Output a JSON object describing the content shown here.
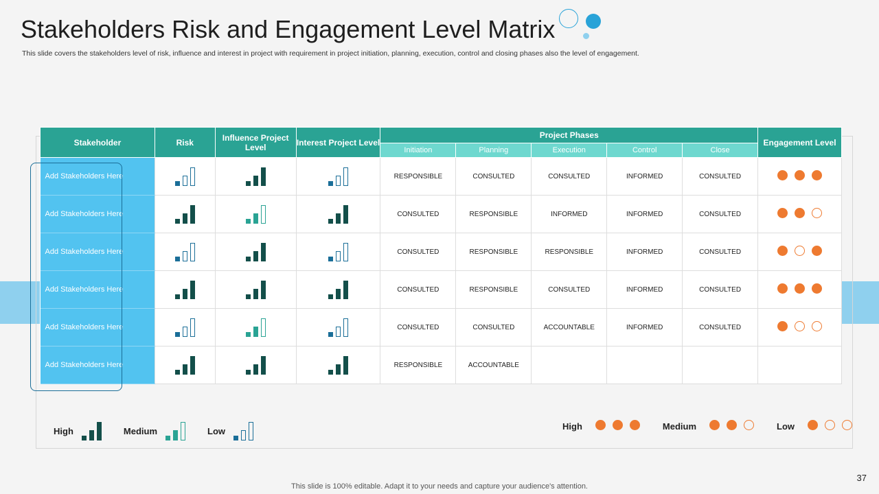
{
  "title": "Stakeholders Risk and Engagement Level Matrix",
  "subtitle": "This slide covers the stakeholders level of risk, influence and interest in project with requirement in project initiation, planning, execution, control and closing phases also the level of engagement.",
  "headers": {
    "stakeholder": "Stakeholder",
    "risk": "Risk",
    "influence": "Influence Project Level",
    "interest": "Interest Project Level",
    "phases": "Project Phases",
    "engagement": "Engagement Level",
    "phase_names": [
      "Initiation",
      "Planning",
      "Execution",
      "Control",
      "Close"
    ]
  },
  "rows": [
    {
      "name": "Add Stakeholders Here",
      "risk": "low",
      "influence": "high",
      "interest": "low",
      "phases": [
        "RESPONSIBLE",
        "CONSULTED",
        "CONSULTED",
        "INFORMED",
        "CONSULTED"
      ],
      "engagement": [
        1,
        1,
        1
      ]
    },
    {
      "name": "Add Stakeholders Here",
      "risk": "high",
      "influence": "medium",
      "interest": "high",
      "phases": [
        "CONSULTED",
        "RESPONSIBLE",
        "INFORMED",
        "INFORMED",
        "CONSULTED"
      ],
      "engagement": [
        1,
        1,
        0
      ]
    },
    {
      "name": "Add Stakeholders Here",
      "risk": "low",
      "influence": "high",
      "interest": "low",
      "phases": [
        "CONSULTED",
        "RESPONSIBLE",
        "RESPONSIBLE",
        "INFORMED",
        "CONSULTED"
      ],
      "engagement": [
        1,
        0,
        1
      ]
    },
    {
      "name": "Add Stakeholders Here",
      "risk": "high",
      "influence": "high",
      "interest": "high",
      "phases": [
        "CONSULTED",
        "RESPONSIBLE",
        "CONSULTED",
        "INFORMED",
        "CONSULTED"
      ],
      "engagement": [
        1,
        1,
        1
      ]
    },
    {
      "name": "Add Stakeholders Here",
      "risk": "low",
      "influence": "medium",
      "interest": "low",
      "phases": [
        "CONSULTED",
        "CONSULTED",
        "ACCOUNTABLE",
        "INFORMED",
        "CONSULTED"
      ],
      "engagement": [
        1,
        0,
        0
      ]
    },
    {
      "name": "Add Stakeholders Here",
      "risk": "high",
      "influence": "high",
      "interest": "high",
      "phases": [
        "RESPONSIBLE",
        "ACCOUNTABLE",
        "",
        "",
        ""
      ],
      "engagement": []
    }
  ],
  "legend_bars": [
    {
      "label": "High",
      "level": "high"
    },
    {
      "label": "Medium",
      "level": "medium"
    },
    {
      "label": "Low",
      "level": "low"
    }
  ],
  "legend_engagement": [
    {
      "label": "High",
      "dots": [
        1,
        1,
        1
      ]
    },
    {
      "label": "Medium",
      "dots": [
        1,
        1,
        0
      ]
    },
    {
      "label": "Low",
      "dots": [
        1,
        0,
        0
      ]
    }
  ],
  "colors": {
    "header": "#2aa394",
    "subheader": "#6ed8cf",
    "stakeholder": "#52c3f0",
    "orange": "#ee7a30"
  },
  "footer": "This slide is 100% editable. Adapt it to your needs and capture your audience's attention.",
  "page_number": "37"
}
